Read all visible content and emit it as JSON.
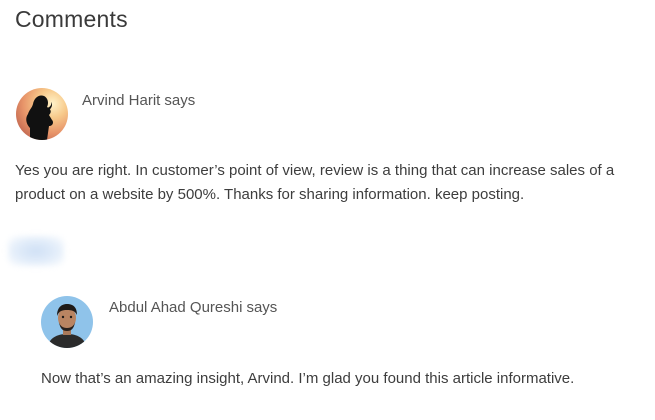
{
  "section": {
    "title": "Comments"
  },
  "comments": [
    {
      "author": "Arvind Harit",
      "says": "says",
      "avatar_icon": "silhouette-sunset-avatar-icon",
      "text": "Yes you are right. In customer’s point of view, review is a thing that can increase sales of a product on a website by 500%. Thanks for sharing information. keep posting."
    },
    {
      "author": "Abdul Ahad Qureshi",
      "says": "says",
      "avatar_icon": "profile-photo-avatar-icon",
      "text": "Now that’s an amazing insight, Arvind. I’m glad you found this article informative."
    }
  ],
  "colors": {
    "reply_blur": "#d6e4f6",
    "avatar_2_bg": "#8fc3ea"
  }
}
